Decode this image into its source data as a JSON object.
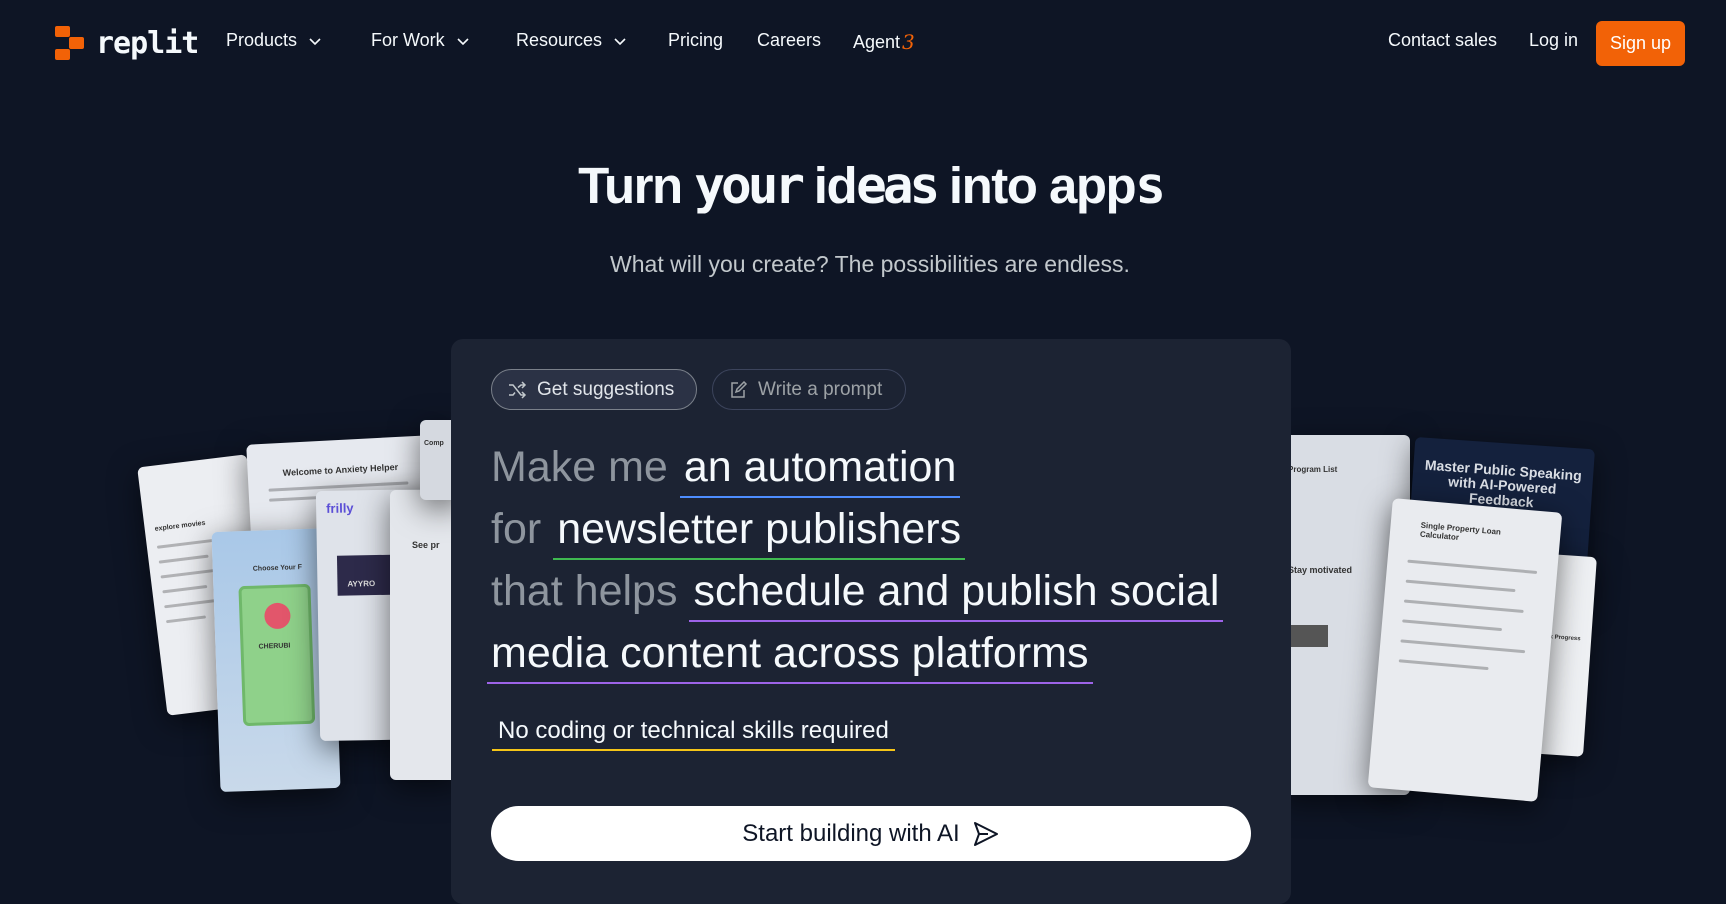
{
  "brand": {
    "name": "replit",
    "accent": "#f26207"
  },
  "nav": {
    "items": [
      {
        "label": "Products",
        "dropdown": true
      },
      {
        "label": "For Work",
        "dropdown": true
      },
      {
        "label": "Resources",
        "dropdown": true
      },
      {
        "label": "Pricing",
        "dropdown": false
      },
      {
        "label": "Careers",
        "dropdown": false
      }
    ],
    "agent_label": "Agent",
    "agent_version": "3",
    "contact_sales": "Contact sales",
    "login": "Log in",
    "signup": "Sign up"
  },
  "hero": {
    "title_parts": [
      "Turn ",
      "your",
      " id",
      "eas",
      " into app",
      "s"
    ],
    "subtitle": "What will you create? The possibilities are endless."
  },
  "panel": {
    "tabs": [
      {
        "label": "Get suggestions",
        "icon": "shuffle-icon",
        "active": true
      },
      {
        "label": "Write a prompt",
        "icon": "edit-icon",
        "active": false
      }
    ],
    "prompt": {
      "prefix1": "Make me",
      "value1": "an automation",
      "prefix2": "for",
      "value2": "newsletter publishers",
      "prefix3": "that helps",
      "value3a": "schedule and publish social",
      "value3b": "media content across platforms"
    },
    "note": "No coding or technical skills required",
    "cta": "Start building with AI",
    "cta_icon": "send-icon"
  },
  "showcase_left": {
    "cards": [
      "Welcome to Anxiety Helper",
      "frilly",
      "explore movies",
      "Choose Your F",
      "CHERUBI",
      "AYYRO",
      "See pr",
      "Comp"
    ]
  },
  "showcase_right": {
    "cards": [
      "Master Public Speaking with AI-Powered Feedback",
      "Single Property Loan Calculator",
      "Stay motivated",
      "Program List",
      "Track Progress"
    ]
  },
  "colors": {
    "background": "#0e1525",
    "panel": "#1c2333",
    "underline_blue": "#4d8dff",
    "underline_green": "#3fb950",
    "underline_purple": "#9d63e8",
    "underline_yellow": "#f5c518"
  }
}
